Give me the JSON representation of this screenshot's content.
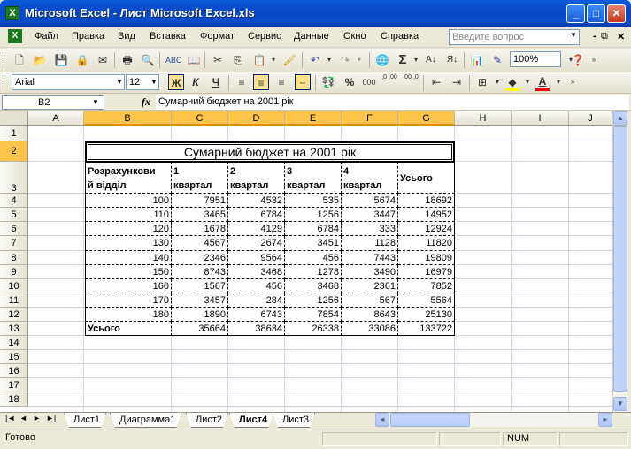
{
  "window": {
    "app_icon_letter": "X",
    "title": "Microsoft Excel - Лист Microsoft Excel.xls",
    "minimize_glyph": "_",
    "maximize_glyph": "□",
    "close_glyph": "✕"
  },
  "menu": {
    "items": [
      "Файл",
      "Правка",
      "Вид",
      "Вставка",
      "Формат",
      "Сервис",
      "Данные",
      "Окно",
      "Справка"
    ],
    "help_placeholder": "Введите вопрос",
    "doc_controls": [
      "-",
      "⧉",
      "✕"
    ]
  },
  "toolbar": {
    "zoom": "100%",
    "font": "Arial",
    "font_size": "12",
    "bold_label": "Ж",
    "italic_label": "К",
    "underline_label": "Ч",
    "sum_label": "Σ",
    "percent_label": "%",
    "thousands_label": "000",
    "inc_decimal_label": ",0 ,00",
    "dec_decimal_label": ",00 ,0",
    "align_center_active": true,
    "fill_color": "#FFFF00",
    "font_color": "#FF0000"
  },
  "formula_bar": {
    "cell_ref": "B2",
    "fx": "fx",
    "content": "Сумарний бюджет на 2001 рік"
  },
  "grid": {
    "columns": [
      "A",
      "B",
      "C",
      "D",
      "E",
      "F",
      "G",
      "H",
      "I",
      "J"
    ],
    "selected_columns": [
      "B",
      "C",
      "D",
      "E",
      "F",
      "G"
    ],
    "rows": [
      "1",
      "2",
      "3",
      "4",
      "5",
      "6",
      "7",
      "8",
      "9",
      "10",
      "11",
      "12",
      "13",
      "14",
      "15",
      "16",
      "17",
      "18"
    ],
    "selected_rows": [
      "2"
    ]
  },
  "table": {
    "title": "Сумарний бюджет на 2001 рік",
    "header": {
      "dept_line1": "Розрахункови",
      "dept_line2": "й відділ",
      "q1_line1": "1",
      "q1_line2": "квартал",
      "q2_line1": "2",
      "q2_line2": "квартал",
      "q3_line1": "3",
      "q3_line2": "квартал",
      "q4_line1": "4",
      "q4_line2": "квартал",
      "total": "Усього"
    },
    "rows": [
      [
        "100",
        "7951",
        "4532",
        "535",
        "5674",
        "18692"
      ],
      [
        "110",
        "3465",
        "6784",
        "1256",
        "3447",
        "14952"
      ],
      [
        "120",
        "1678",
        "4129",
        "6784",
        "333",
        "12924"
      ],
      [
        "130",
        "4567",
        "2674",
        "3451",
        "1128",
        "11820"
      ],
      [
        "140",
        "2346",
        "9564",
        "456",
        "7443",
        "19809"
      ],
      [
        "150",
        "8743",
        "3468",
        "1278",
        "3490",
        "16979"
      ],
      [
        "160",
        "1567",
        "456",
        "3468",
        "2361",
        "7852"
      ],
      [
        "170",
        "3457",
        "284",
        "1256",
        "567",
        "5564"
      ],
      [
        "180",
        "1890",
        "6743",
        "7854",
        "8643",
        "25130"
      ]
    ],
    "total_row": [
      "Усього",
      "35664",
      "38634",
      "26338",
      "33086",
      "133722"
    ]
  },
  "sheets": {
    "nav": [
      "|◄",
      "◄",
      "►",
      "►|"
    ],
    "tabs": [
      "Лист1",
      "Диаграмма1",
      "Лист2",
      "Лист4",
      "Лист3"
    ],
    "active": "Лист4"
  },
  "status": {
    "text": "Готово",
    "num": "NUM"
  }
}
